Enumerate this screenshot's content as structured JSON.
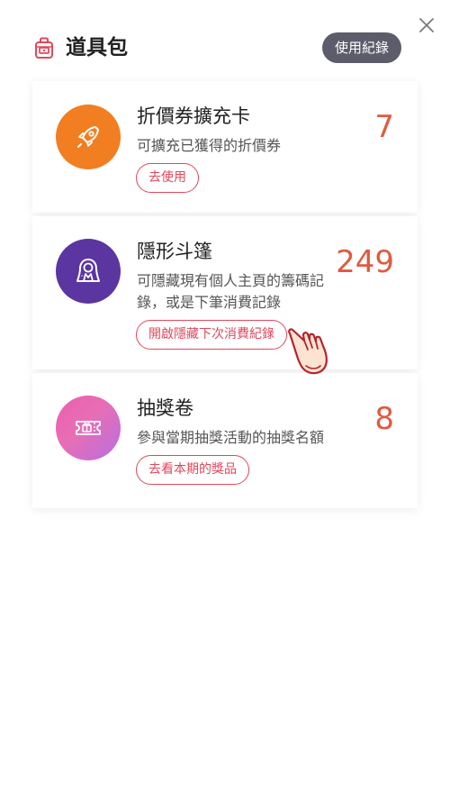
{
  "header": {
    "title": "道具包",
    "history_button": "使用紀錄"
  },
  "items": [
    {
      "name": "折價券擴充卡",
      "description": "可擴充已獲得的折價券",
      "count": "7",
      "action_label": "去使用",
      "icon": "rocket-icon",
      "icon_color": "#f27e22"
    },
    {
      "name": "隱形斗篷",
      "description": "可隱藏現有個人主頁的籌碼記錄，或是下筆消費記錄",
      "count": "249",
      "action_label": "開啟隱藏下次消費紀錄",
      "icon": "hooded-cloak-icon",
      "icon_color": "#5b35a0"
    },
    {
      "name": "抽獎卷",
      "description": "參與當期抽獎活動的抽獎名額",
      "count": "8",
      "action_label": "去看本期的獎品",
      "icon": "ticket-icon",
      "icon_color": "#e66fb6"
    }
  ],
  "colors": {
    "accent": "#e0485c",
    "count": "#e05a3f",
    "history_button_bg": "#5c5c6b"
  }
}
